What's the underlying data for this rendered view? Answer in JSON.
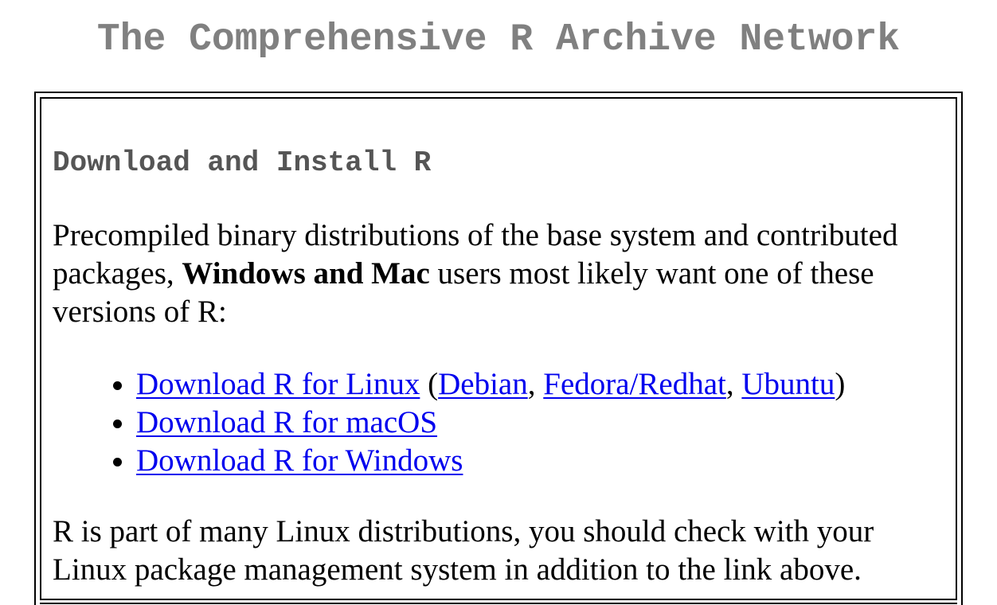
{
  "page": {
    "title": "The Comprehensive R Archive Network"
  },
  "download_section": {
    "heading": "Download and Install R",
    "intro_before": "Precompiled binary distributions of the base system and contributed packages, ",
    "intro_bold": "Windows and Mac",
    "intro_after": " users most likely want one of these versions of R:",
    "links": {
      "linux": "Download R for Linux",
      "open_paren": " (",
      "debian": "Debian",
      "comma_1": ", ",
      "fedora": "Fedora/Redhat",
      "comma_2": ", ",
      "ubuntu": "Ubuntu",
      "close_paren": ")",
      "macos": "Download R for macOS",
      "windows": "Download R for Windows"
    },
    "note": "R is part of many Linux distributions, you should check with your Linux package management system in addition to the link above."
  },
  "colors": {
    "title_gray": "#808080",
    "heading_gray": "#555555",
    "link_blue": "#0000ee",
    "text": "#000000",
    "border": "#000000"
  }
}
